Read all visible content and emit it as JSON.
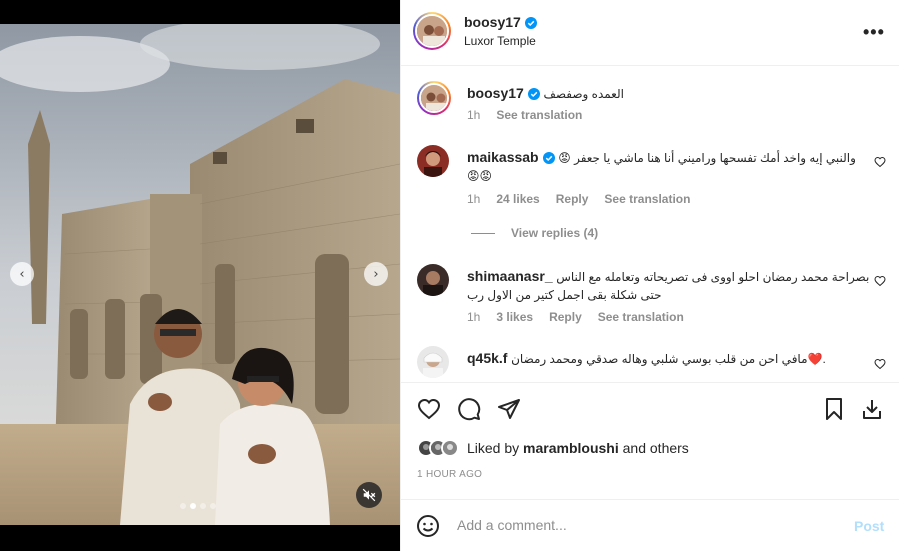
{
  "post": {
    "username": "boosy17",
    "location": "Luxor Temple",
    "more_label": "•••"
  },
  "media": {
    "prev_icon": "‹",
    "next_icon": "›",
    "dots_count": 4,
    "active_dot": 1
  },
  "caption": {
    "username": "boosy17",
    "text": "العمده وصفصف",
    "time": "1h",
    "translate": "See translation"
  },
  "comments": [
    {
      "username": "maikassab",
      "verified": true,
      "text": "😡 والنبي إيه واخد أمك تفسحها وراميني أنا هنا ماشي يا جعفر",
      "text2": "😡😡",
      "time": "1h",
      "likes": "24 likes",
      "reply": "Reply",
      "translate": "See translation",
      "view_replies": "View replies (4)"
    },
    {
      "username": "shimaanasr_",
      "verified": false,
      "text": "بصراحة محمد رمضان احلو اووى فى تصريحاته وتعامله مع الناس",
      "text2": "حتى شكلة بقى اجمل كتير من الاول رب",
      "time": "1h",
      "likes": "3 likes",
      "reply": "Reply",
      "translate": "See translation"
    },
    {
      "username": "q45k.f",
      "verified": false,
      "text": "مافي احن من قلب بوسي شلبي وهاله صدقي ومحمد رمضان❤️."
    }
  ],
  "likes": {
    "prefix": "Liked by",
    "user": "marambloushi",
    "suffix": "and others"
  },
  "time_ago": "1 HOUR AGO",
  "add_comment": {
    "placeholder": "Add a comment...",
    "post_label": "Post"
  },
  "colors": {
    "verified": "#0095f6",
    "post_disabled": "#b2dffc",
    "secondary_text": "#8e8e8e"
  }
}
